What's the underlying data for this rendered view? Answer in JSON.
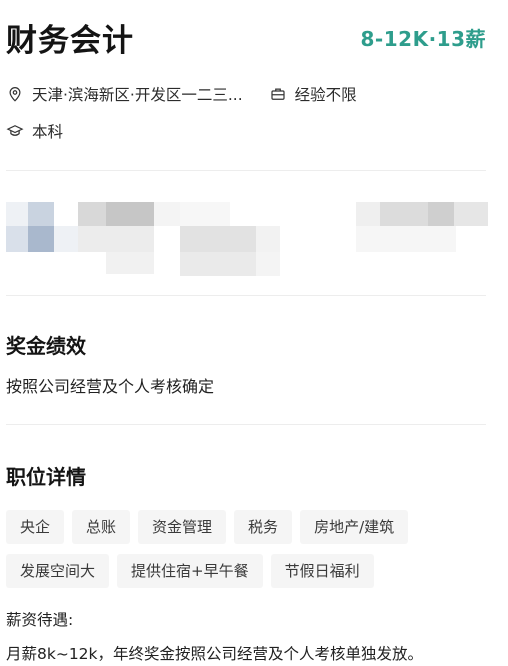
{
  "job": {
    "title": "财务会计",
    "salary": "8-12K·13薪",
    "location": "天津·滨海新区·开发区一二三...",
    "experience": "经验不限",
    "education": "本科"
  },
  "bonus": {
    "heading": "奖金绩效",
    "text": "按照公司经营及个人考核确定"
  },
  "details": {
    "heading": "职位详情",
    "tags": [
      "央企",
      "总账",
      "资金管理",
      "税务",
      "房地产/建筑",
      "发展空间大",
      "提供住宿+早午餐",
      "节假日福利"
    ],
    "salary_label": "薪资待遇:",
    "salary_text": "月薪8k~12k，年终奖金按照公司经营及个人考核单独发放。"
  },
  "icons": {
    "location": "location-pin-icon",
    "experience": "briefcase-icon",
    "education": "graduation-cap-icon"
  },
  "colors": {
    "accent": "#2e9d8c"
  }
}
